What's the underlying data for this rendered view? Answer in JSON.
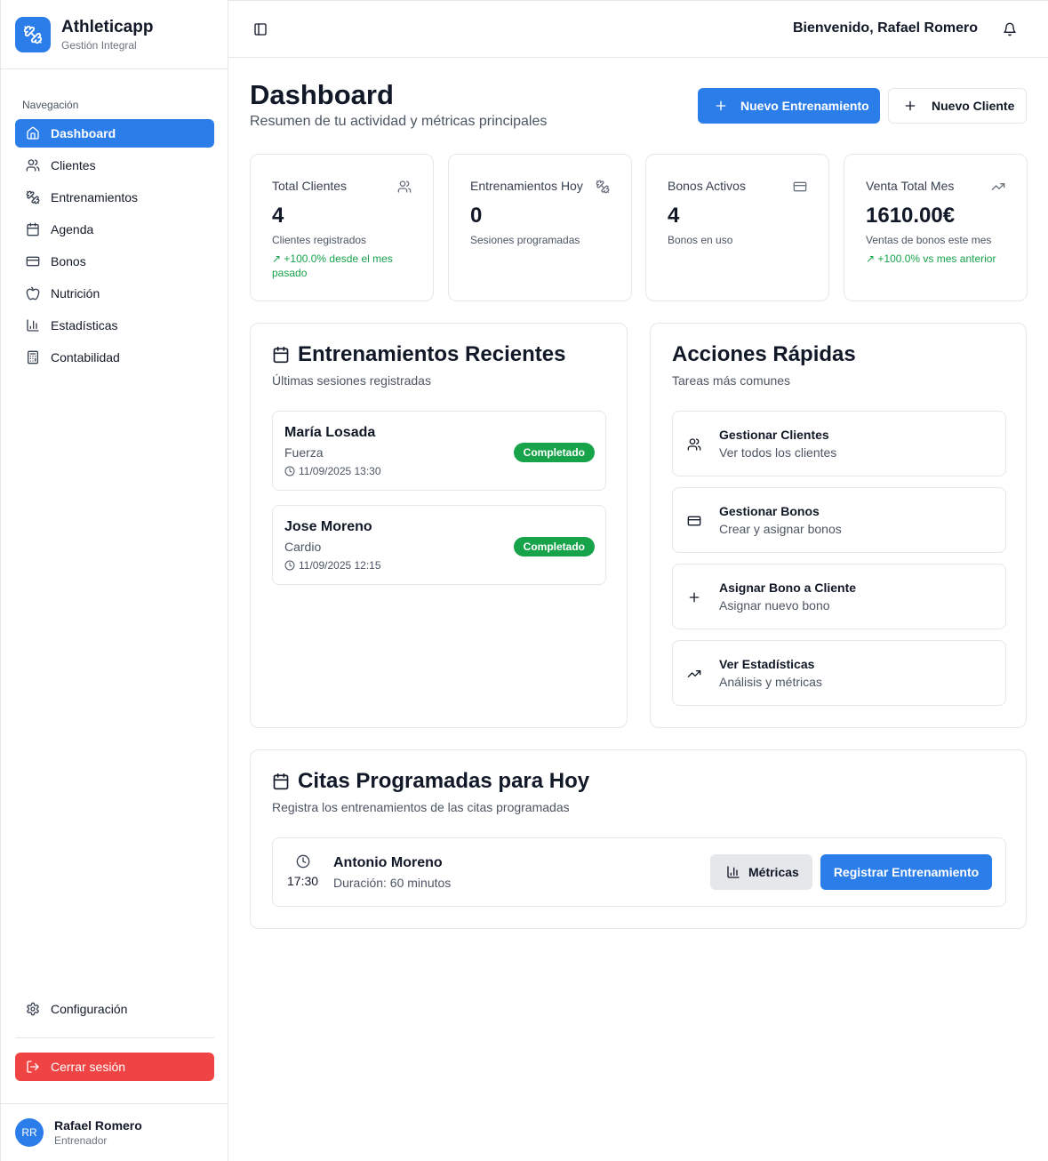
{
  "app": {
    "name": "Athleticapp",
    "subtitle": "Gestión Integral"
  },
  "sidebar": {
    "heading": "Navegación",
    "items": [
      {
        "label": "Dashboard",
        "icon": "home-icon",
        "active": true
      },
      {
        "label": "Clientes",
        "icon": "users-icon"
      },
      {
        "label": "Entrenamientos",
        "icon": "dumbbell-icon"
      },
      {
        "label": "Agenda",
        "icon": "calendar-icon"
      },
      {
        "label": "Bonos",
        "icon": "credit-card-icon"
      },
      {
        "label": "Nutrición",
        "icon": "apple-icon"
      },
      {
        "label": "Estadísticas",
        "icon": "bar-chart-icon"
      },
      {
        "label": "Contabilidad",
        "icon": "calculator-icon"
      }
    ],
    "config_label": "Configuración",
    "logout_label": "Cerrar sesión",
    "user": {
      "initials": "RR",
      "name": "Rafael Romero",
      "role": "Entrenador"
    }
  },
  "topbar": {
    "welcome": "Bienvenido, Rafael Romero"
  },
  "header": {
    "title": "Dashboard",
    "subtitle": "Resumen de tu actividad y métricas principales",
    "new_training_label": "Nuevo Entrenamiento",
    "new_client_label": "Nuevo Cliente"
  },
  "stats": [
    {
      "label": "Total Clientes",
      "value": "4",
      "desc": "Clientes registrados",
      "trend": "↗ +100.0% desde el mes pasado",
      "icon": "users-icon"
    },
    {
      "label": "Entrenamientos Hoy",
      "value": "0",
      "desc": "Sesiones programadas",
      "trend": "",
      "icon": "dumbbell-icon"
    },
    {
      "label": "Bonos Activos",
      "value": "4",
      "desc": "Bonos en uso",
      "trend": "",
      "icon": "credit-card-icon"
    },
    {
      "label": "Venta Total Mes",
      "value": "1610.00€",
      "desc": "Ventas de bonos este mes",
      "trend": "↗ +100.0% vs mes anterior",
      "icon": "trending-up-icon"
    }
  ],
  "recent": {
    "title": "Entrenamientos Recientes",
    "subtitle": "Últimas sesiones registradas",
    "items": [
      {
        "name": "María Losada",
        "type": "Fuerza",
        "date": "11/09/2025 13:30",
        "status": "Completado"
      },
      {
        "name": "Jose Moreno",
        "type": "Cardio",
        "date": "11/09/2025 12:15",
        "status": "Completado"
      }
    ]
  },
  "quick": {
    "title": "Acciones Rápidas",
    "subtitle": "Tareas más comunes",
    "items": [
      {
        "title": "Gestionar Clientes",
        "sub": "Ver todos los clientes",
        "icon": "users-icon"
      },
      {
        "title": "Gestionar Bonos",
        "sub": "Crear y asignar bonos",
        "icon": "credit-card-icon"
      },
      {
        "title": "Asignar Bono a Cliente",
        "sub": "Asignar nuevo bono",
        "icon": "plus-icon"
      },
      {
        "title": "Ver Estadísticas",
        "sub": "Análisis y métricas",
        "icon": "trending-up-icon"
      }
    ]
  },
  "appointments": {
    "title": "Citas Programadas para Hoy",
    "subtitle": "Registra los entrenamientos de las citas programadas",
    "items": [
      {
        "time": "17:30",
        "name": "Antonio Moreno",
        "duration": "Duración: 60 minutos",
        "metrics_label": "Métricas",
        "register_label": "Registrar Entrenamiento"
      }
    ]
  },
  "colors": {
    "primary": "#2b7de9",
    "danger": "#ef4444",
    "success": "#16a34a"
  }
}
